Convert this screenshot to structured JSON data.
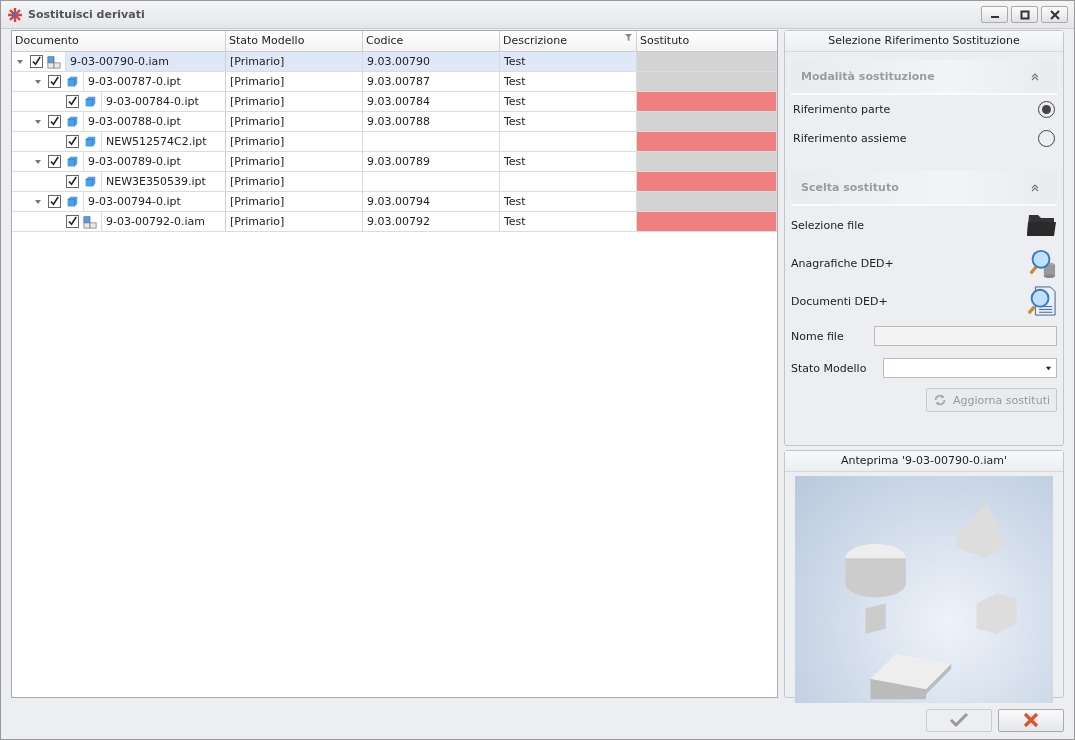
{
  "window": {
    "title": "Sostituisci derivati"
  },
  "table": {
    "columns": [
      {
        "label": "Documento",
        "filter": false
      },
      {
        "label": "Stato Modello",
        "filter": false
      },
      {
        "label": "Codice",
        "filter": false
      },
      {
        "label": "Descrizione",
        "filter": true
      },
      {
        "label": "Sostituto",
        "filter": false
      }
    ],
    "rows": [
      {
        "name": "9-03-00790-0.iam",
        "kind": "assembly",
        "checked": true,
        "expanded": true,
        "selected": true,
        "stato": "[Primario]",
        "codice": "9.03.00790",
        "descrizione": "Test",
        "color": "#d3d3d3",
        "children": [
          {
            "name": "9-03-00787-0.ipt",
            "kind": "part",
            "checked": true,
            "expanded": true,
            "selected": false,
            "stato": "[Primario]",
            "codice": "9.03.00787",
            "descrizione": "Test",
            "color": "#d3d3d3",
            "children": [
              {
                "name": "9-03-00784-0.ipt",
                "kind": "part",
                "checked": true,
                "selected": false,
                "stato": "[Primario]",
                "codice": "9.03.00784",
                "descrizione": "Test",
                "color": "#f08080"
              }
            ]
          },
          {
            "name": "9-03-00788-0.ipt",
            "kind": "part",
            "checked": true,
            "expanded": true,
            "selected": false,
            "stato": "[Primario]",
            "codice": "9.03.00788",
            "descrizione": "Test",
            "color": "#d3d3d3",
            "children": [
              {
                "name": "NEW512574C2.ipt",
                "kind": "part",
                "checked": true,
                "selected": false,
                "stato": "[Primario]",
                "color": "#f08080"
              }
            ]
          },
          {
            "name": "9-03-00789-0.ipt",
            "kind": "part",
            "checked": true,
            "expanded": true,
            "selected": false,
            "stato": "[Primario]",
            "codice": "9.03.00789",
            "descrizione": "Test",
            "color": "#d3d3d3",
            "children": [
              {
                "name": "NEW3E350539.ipt",
                "kind": "part",
                "checked": true,
                "selected": false,
                "stato": "[Primario]",
                "color": "#f08080"
              }
            ]
          },
          {
            "name": "9-03-00794-0.ipt",
            "kind": "part",
            "checked": true,
            "expanded": true,
            "selected": false,
            "stato": "[Primario]",
            "codice": "9.03.00794",
            "descrizione": "Test",
            "color": "#d3d3d3",
            "children": [
              {
                "name": "9-03-00792-0.iam",
                "kind": "assembly",
                "checked": true,
                "selected": false,
                "stato": "[Primario]",
                "codice": "9.03.00792",
                "descrizione": "Test",
                "color": "#f08080"
              }
            ]
          }
        ]
      }
    ]
  },
  "panel": {
    "title": "Selezione Riferimento Sostituzione",
    "mode_section": {
      "title": "Modalità sostituzione",
      "expanded": true,
      "options": [
        {
          "label": "Riferimento parte",
          "selected": true
        },
        {
          "label": "Riferimento assieme",
          "selected": false
        }
      ]
    },
    "choice_section": {
      "title": "Scelta sostituto",
      "expanded": true,
      "actions": [
        {
          "label": "Selezione file",
          "kind": "folder"
        },
        {
          "label": "Anagrafiche DED+",
          "kind": "database"
        },
        {
          "label": "Documenti DED+",
          "kind": "document"
        }
      ],
      "fields": [
        {
          "label": "Nome file",
          "kind": "text",
          "disabled": true
        },
        {
          "label": "Stato Modello",
          "kind": "dropdown",
          "disabled": false
        }
      ],
      "update_button": {
        "label": "Aggiorna sostituti",
        "disabled": true
      }
    }
  },
  "preview": {
    "title": "Anteprima '9-03-00790-0.iam'"
  },
  "buttons": [
    {
      "kind": "confirm",
      "disabled": true
    },
    {
      "kind": "cancel",
      "disabled": false
    }
  ]
}
